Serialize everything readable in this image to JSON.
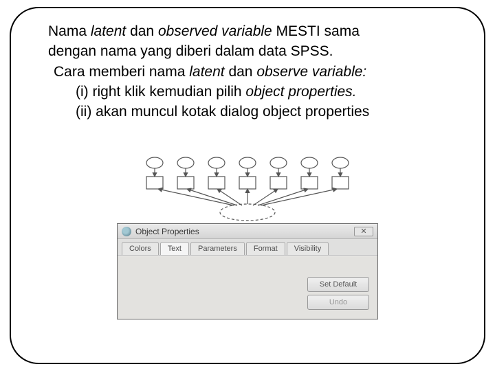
{
  "text": {
    "line1a": "Nama ",
    "line1b": "latent",
    "line1c": " dan ",
    "line1d": "observed variable",
    "line1e": " MESTI sama",
    "line2": "dengan nama yang diberi dalam data SPSS.",
    "line3a": "Cara memberi nama ",
    "line3b": "latent",
    "line3c": " dan ",
    "line3d": "observe variable:",
    "line4a": "(i)   right klik kemudian pilih ",
    "line4b": "object properties.",
    "line5": "(ii) akan muncul kotak dialog object properties"
  },
  "dialog": {
    "title": "Object Properties",
    "tabs": [
      "Colors",
      "Text",
      "Parameters",
      "Format",
      "Visibility"
    ],
    "buttons": {
      "set_default": "Set Default",
      "undo": "Undo"
    }
  }
}
